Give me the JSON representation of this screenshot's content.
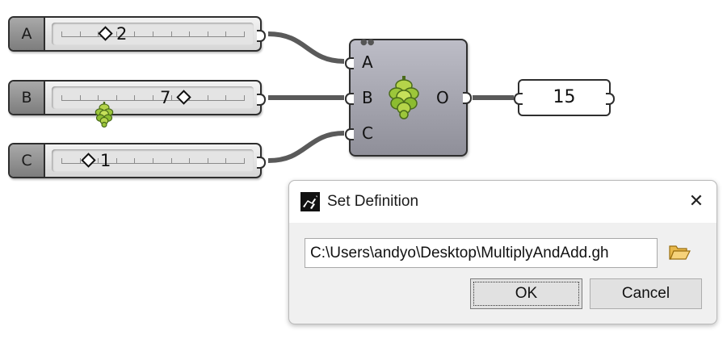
{
  "sliders": [
    {
      "name": "A",
      "value": "2",
      "range_min": 0,
      "range_max": 10
    },
    {
      "name": "B",
      "value": "7",
      "range_min": 0,
      "range_max": 10
    },
    {
      "name": "C",
      "value": "1",
      "range_min": 0,
      "range_max": 10
    }
  ],
  "cluster": {
    "inputs": [
      "A",
      "B",
      "C"
    ],
    "output": "O",
    "icon": "hops-icon"
  },
  "panel": {
    "value": "15"
  },
  "dialog": {
    "title": "Set Definition",
    "title_icon": "grasshopper-icon",
    "close_label": "✕",
    "path_value": "C:\\Users\\andyo\\Desktop\\MultiplyAndAdd.gh",
    "browse_icon": "folder-open-icon",
    "ok_label": "OK",
    "cancel_label": "Cancel"
  },
  "colors": {
    "wire": "#5a5a5a",
    "component_fill": "#a4a4ae",
    "hops_green": "#8cc63f"
  }
}
